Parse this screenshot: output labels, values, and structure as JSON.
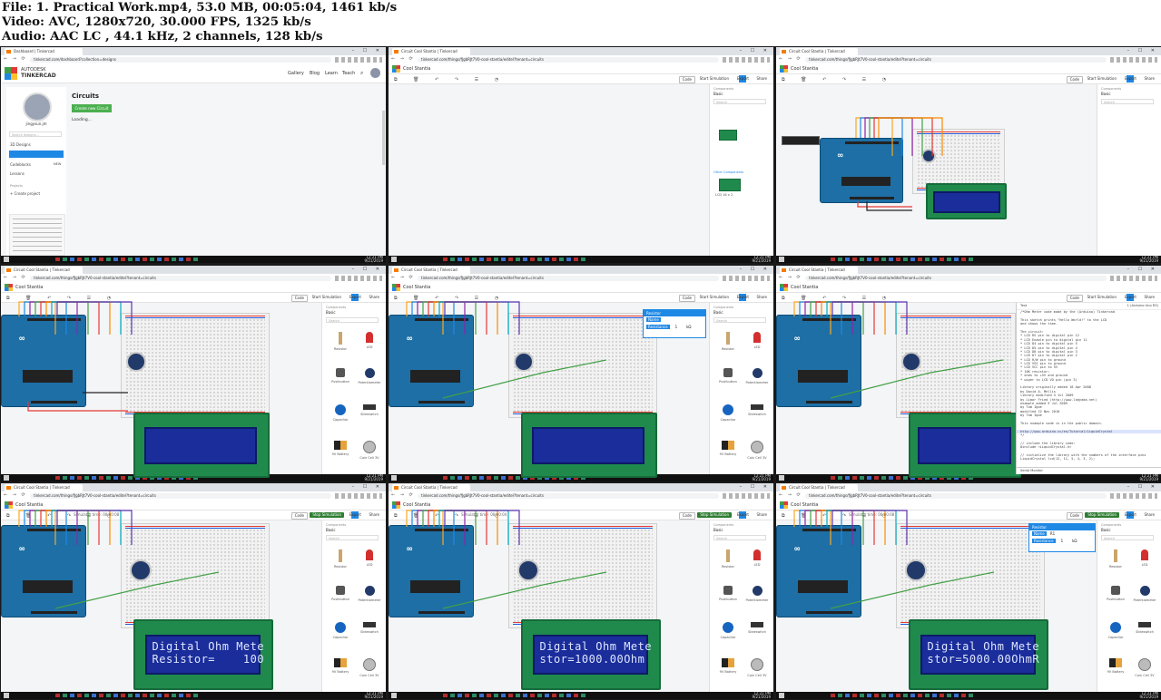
{
  "header": {
    "file_line": "File: 1. Practical Work.mp4, 53.0 MB, 00:05:04, 1461 kb/s",
    "video_line": "Video: AVC, 1280x720, 30.000 FPS, 1325 kb/s",
    "audio_line": "Audio: AAC LC , 44.1 kHz, 2 channels, 128 kb/s"
  },
  "browser": {
    "tab_dashboard": "Dashboard | Tinkercad",
    "tab_circuit": "Circuit Cool Stantia | Tinkercad",
    "url_dashboard": "tinkercad.com/dashboard?collection=designs",
    "url_circuit": "tinkercad.com/things/fJgbRJt7V0-cool-stantia/editel?tenant=circuits",
    "nav_glyphs": "← → ⟳",
    "window_controls": "– ☐ ✕"
  },
  "dashboard": {
    "brand_top": "AUTODESK",
    "brand_bottom": "TINKERCAD",
    "nav": [
      "Gallery",
      "Blog",
      "Learn",
      "Teach"
    ],
    "username": "jingysun.jm",
    "search_placeholder": "Search designs...",
    "menu": [
      "3D Designs",
      "Circuits",
      "Codeblocks",
      "Lessons"
    ],
    "codeblocks_badge": "NEW",
    "projects_label": "Projects",
    "create_project": "+ Create project",
    "heading": "Circuits",
    "create_button": "Create new Circuit",
    "loading": "Loading..."
  },
  "editor": {
    "design_title": "Cool Stantia",
    "code_button": "Code",
    "start_sim": "Start Simulation",
    "stop_sim": "Stop Simulation",
    "export": "Export",
    "share": "Share",
    "tool_icons": "⧉ 🗑 ↶ ↷ ☰ ◔",
    "components_label": "Components",
    "components_value": "Basic",
    "search_placeholder": "Search",
    "other_components": "Other Components",
    "sim_time_1": "Simulator time: 00:00:08",
    "sim_time_2": "Simulator time: 00:00:04",
    "component_names": [
      "Resistor",
      "LED",
      "Pushbutton",
      "Potentiometer",
      "Capacitor",
      "Slideswitch",
      "9V Battery",
      "Coin Cell 3V"
    ],
    "text_tab": "Text",
    "code_file": "1 (Arduino Uno R3)",
    "serial_monitor": "Serial Monitor",
    "lcd_label": "LCD 16 x 2"
  },
  "popup": {
    "title": "Resistor",
    "name_label": "Name",
    "name_value": "R1",
    "resistance_label": "Resistance",
    "resistance_value": "1",
    "unit": "kΩ"
  },
  "lcd_readings": [
    {
      "line1": "Digital Ohm Mete",
      "line2": "Resistor=    100"
    },
    {
      "line1": "Digital Ohm Mete",
      "line2": "stor=1000.00Ohm"
    },
    {
      "line1": "Digital Ohm Mete",
      "line2": "stor=5000.00OhmR"
    }
  ],
  "code_lines": [
    "/*Ohm Meter code made by the (Arduino) Tinkercad",
    "",
    "  This sketch prints \"Hello World!\" to the LCD",
    "  and shows the time.",
    "",
    "  The circuit:",
    "  * LCD RS pin to digital pin 12",
    "  * LCD Enable pin to digital pin 11",
    "  * LCD D4 pin to digital pin 5",
    "  * LCD D5 pin to digital pin 4",
    "  * LCD D6 pin to digital pin 3",
    "  * LCD D7 pin to digital pin 2",
    "  * LCD R/W pin to ground",
    "  * LCD VSS pin to ground",
    "  * LCD VCC pin to 5V",
    "  * 10K resistor:",
    "  * ends to +5V and ground",
    "  * wiper to LCD VO pin (pin 3)",
    "",
    "  Library originally added 18 Apr 2008",
    "  by David A. Mellis",
    "  library modified 5 Jul 2009",
    "  by Limor Fried (http://www.ladyada.net)",
    "  example added 9 Jul 2009",
    "  by Tom Igoe",
    "  modified 22 Nov 2010",
    "  by Tom Igoe",
    "",
    "  This example code is in the public domain.",
    "",
    "  http://www.arduino.cc/en/Tutorial/LiquidCrystal",
    "*/",
    "",
    "// include the library code:",
    "#include <LiquidCrystal.h>",
    "",
    "// initialize the library with the numbers of the interface pins",
    "LiquidCrystal lcd(12, 11, 5, 4, 3, 2);"
  ],
  "taskbar": {
    "time": "12:21 PM",
    "date": "9/21/2019"
  },
  "colors": {
    "tinkercad_blue": "#1e88e5",
    "sim_green": "#2e7d32",
    "arduino_blue": "#1d6fa5",
    "lcd_screen": "#1a2d9a",
    "lcd_board": "#1f8a4c"
  }
}
